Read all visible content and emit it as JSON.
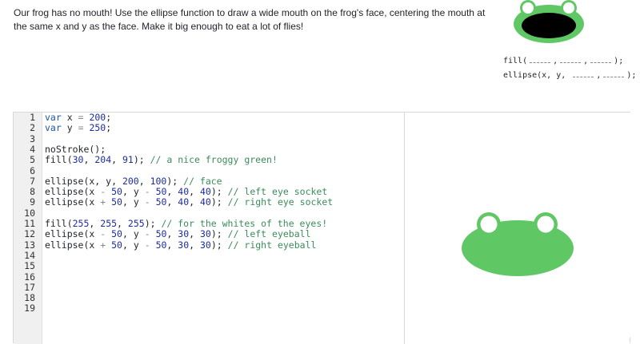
{
  "instructions": "Our frog has no mouth! Use the ellipse function to draw a wide mouth on the frog's face, centering the mouth at the same x and y as the face. Make it big enough to eat a lot of flies!",
  "hint": {
    "line1_prefix": "fill(",
    "line1_sep": ",",
    "line1_suffix": ");",
    "line2_prefix": "ellipse(x, y,",
    "line2_sep": ",",
    "line2_suffix": ");"
  },
  "code": {
    "line_numbers": [
      "1",
      "2",
      "3",
      "4",
      "5",
      "6",
      "7",
      "8",
      "9",
      "10",
      "11",
      "12",
      "13",
      "14",
      "15",
      "16",
      "17",
      "18",
      "19"
    ],
    "lines": [
      {
        "tokens": [
          [
            "kw",
            "var"
          ],
          [
            "",
            "x"
          ],
          [
            "op",
            " = "
          ],
          [
            "num",
            "200"
          ],
          [
            "",
            ";"
          ]
        ]
      },
      {
        "tokens": [
          [
            "kw",
            "var"
          ],
          [
            "",
            "y"
          ],
          [
            "op",
            " = "
          ],
          [
            "num",
            "250"
          ],
          [
            "",
            ";"
          ]
        ]
      },
      {
        "tokens": []
      },
      {
        "tokens": [
          [
            "",
            "noStroke();"
          ]
        ]
      },
      {
        "tokens": [
          [
            "",
            "fill("
          ],
          [
            "num",
            "30"
          ],
          [
            "",
            ", "
          ],
          [
            "num",
            "204"
          ],
          [
            "",
            ", "
          ],
          [
            "num",
            "91"
          ],
          [
            "",
            "); "
          ],
          [
            "cm",
            "// a nice froggy green!"
          ]
        ]
      },
      {
        "tokens": []
      },
      {
        "tokens": [
          [
            "",
            "ellipse(x, y, "
          ],
          [
            "num",
            "200"
          ],
          [
            "",
            ", "
          ],
          [
            "num",
            "100"
          ],
          [
            "",
            "); "
          ],
          [
            "cm",
            "// face"
          ]
        ]
      },
      {
        "tokens": [
          [
            "",
            "ellipse(x "
          ],
          [
            "op",
            "-"
          ],
          [
            "",
            " "
          ],
          [
            "num",
            "50"
          ],
          [
            "",
            ", y "
          ],
          [
            "op",
            "-"
          ],
          [
            "",
            " "
          ],
          [
            "num",
            "50"
          ],
          [
            "",
            ", "
          ],
          [
            "num",
            "40"
          ],
          [
            "",
            ", "
          ],
          [
            "num",
            "40"
          ],
          [
            "",
            "); "
          ],
          [
            "cm",
            "// left eye socket"
          ]
        ]
      },
      {
        "tokens": [
          [
            "",
            "ellipse(x "
          ],
          [
            "op",
            "+"
          ],
          [
            "",
            " "
          ],
          [
            "num",
            "50"
          ],
          [
            "",
            ", y "
          ],
          [
            "op",
            "-"
          ],
          [
            "",
            " "
          ],
          [
            "num",
            "50"
          ],
          [
            "",
            ", "
          ],
          [
            "num",
            "40"
          ],
          [
            "",
            ", "
          ],
          [
            "num",
            "40"
          ],
          [
            "",
            "); "
          ],
          [
            "cm",
            "// right eye socket"
          ]
        ]
      },
      {
        "tokens": []
      },
      {
        "tokens": [
          [
            "",
            "fill("
          ],
          [
            "num",
            "255"
          ],
          [
            "",
            ", "
          ],
          [
            "num",
            "255"
          ],
          [
            "",
            ", "
          ],
          [
            "num",
            "255"
          ],
          [
            "",
            "); "
          ],
          [
            "cm",
            "// for the whites of the eyes!"
          ]
        ]
      },
      {
        "tokens": [
          [
            "",
            "ellipse(x "
          ],
          [
            "op",
            "-"
          ],
          [
            "",
            " "
          ],
          [
            "num",
            "50"
          ],
          [
            "",
            ", y "
          ],
          [
            "op",
            "-"
          ],
          [
            "",
            " "
          ],
          [
            "num",
            "50"
          ],
          [
            "",
            ", "
          ],
          [
            "num",
            "30"
          ],
          [
            "",
            ", "
          ],
          [
            "num",
            "30"
          ],
          [
            "",
            "); "
          ],
          [
            "cm",
            "// left eyeball"
          ]
        ]
      },
      {
        "tokens": [
          [
            "",
            "ellipse(x "
          ],
          [
            "op",
            "+"
          ],
          [
            "",
            " "
          ],
          [
            "num",
            "50"
          ],
          [
            "",
            ", y "
          ],
          [
            "op",
            "-"
          ],
          [
            "",
            " "
          ],
          [
            "num",
            "50"
          ],
          [
            "",
            ", "
          ],
          [
            "num",
            "30"
          ],
          [
            "",
            ", "
          ],
          [
            "num",
            "30"
          ],
          [
            "",
            "); "
          ],
          [
            "cm",
            "// right eyeball"
          ]
        ]
      },
      {
        "tokens": []
      },
      {
        "tokens": []
      },
      {
        "tokens": []
      },
      {
        "tokens": []
      },
      {
        "tokens": []
      },
      {
        "tokens": []
      }
    ]
  },
  "colors": {
    "frog_green": "#5fc865",
    "eye_white": "#ffffff",
    "mouth_black": "#000000"
  }
}
